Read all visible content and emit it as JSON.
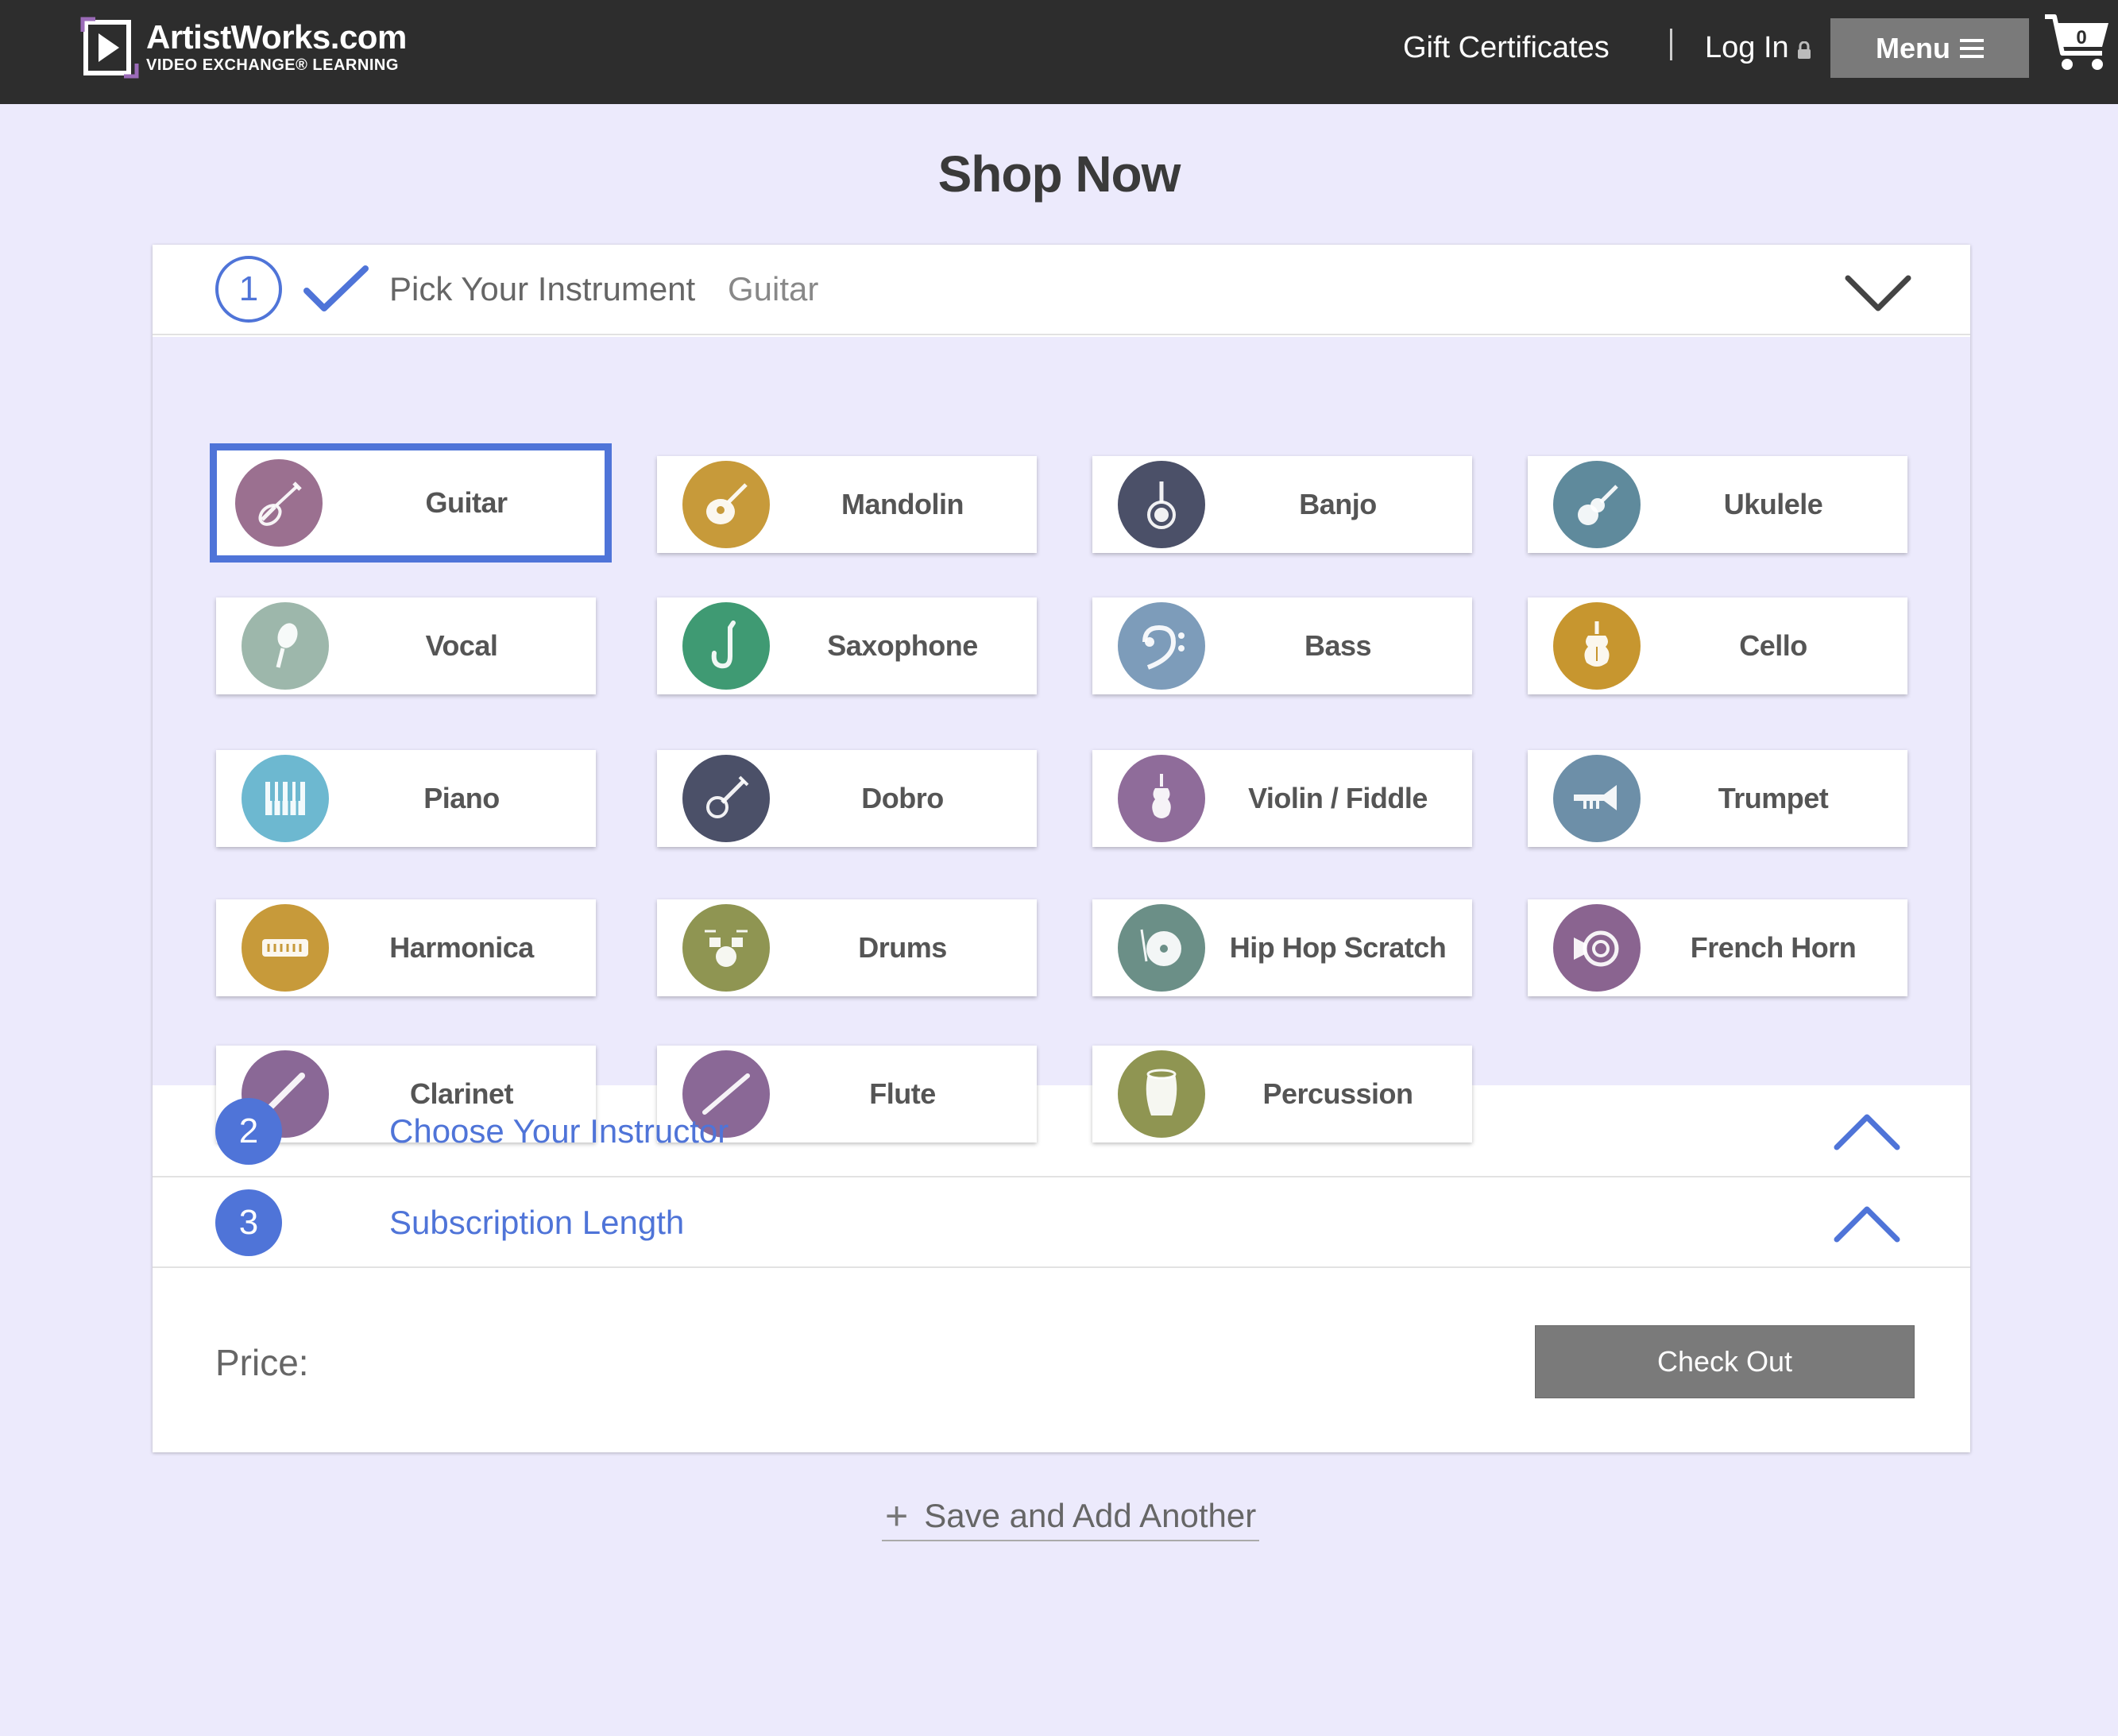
{
  "header": {
    "logo_title": "ArtistWorks.com",
    "logo_subtitle": "VIDEO EXCHANGE® LEARNING",
    "gift_certificates": "Gift Certificates",
    "login": "Log In",
    "menu": "Menu",
    "cart_count": "0"
  },
  "page_title": "Shop Now",
  "steps": [
    {
      "number": "1",
      "label": "Pick Your Instrument",
      "value": "Guitar",
      "state": "complete"
    },
    {
      "number": "2",
      "label": "Choose Your Instructor",
      "value": "",
      "state": "pending"
    },
    {
      "number": "3",
      "label": "Subscription Length",
      "value": "",
      "state": "pending"
    }
  ],
  "instruments": [
    {
      "name": "Guitar",
      "color": "#9b7090",
      "icon": "guitar-icon",
      "selected": true
    },
    {
      "name": "Mandolin",
      "color": "#c79a3a",
      "icon": "mandolin-icon",
      "selected": false
    },
    {
      "name": "Banjo",
      "color": "#4b5068",
      "icon": "banjo-icon",
      "selected": false
    },
    {
      "name": "Ukulele",
      "color": "#5f8a9c",
      "icon": "ukulele-icon",
      "selected": false
    },
    {
      "name": "Vocal",
      "color": "#9db7ab",
      "icon": "microphone-icon",
      "selected": false
    },
    {
      "name": "Saxophone",
      "color": "#3f9a73",
      "icon": "saxophone-icon",
      "selected": false
    },
    {
      "name": "Bass",
      "color": "#7d9cba",
      "icon": "bass-clef-icon",
      "selected": false
    },
    {
      "name": "Cello",
      "color": "#c7962f",
      "icon": "cello-icon",
      "selected": false
    },
    {
      "name": "Piano",
      "color": "#6db8d0",
      "icon": "piano-icon",
      "selected": false
    },
    {
      "name": "Dobro",
      "color": "#4b5068",
      "icon": "dobro-icon",
      "selected": false
    },
    {
      "name": "Violin / Fiddle",
      "color": "#8f6c9a",
      "icon": "violin-icon",
      "selected": false
    },
    {
      "name": "Trumpet",
      "color": "#6d8fa8",
      "icon": "trumpet-icon",
      "selected": false
    },
    {
      "name": "Harmonica",
      "color": "#c79a3a",
      "icon": "harmonica-icon",
      "selected": false
    },
    {
      "name": "Drums",
      "color": "#8f9552",
      "icon": "drums-icon",
      "selected": false
    },
    {
      "name": "Hip Hop Scratch",
      "color": "#6b8f87",
      "icon": "turntable-icon",
      "selected": false
    },
    {
      "name": "French Horn",
      "color": "#8a6490",
      "icon": "french-horn-icon",
      "selected": false
    },
    {
      "name": "Clarinet",
      "color": "#8a6896",
      "icon": "clarinet-icon",
      "selected": false
    },
    {
      "name": "Flute",
      "color": "#8a6896",
      "icon": "flute-icon",
      "selected": false
    },
    {
      "name": "Percussion",
      "color": "#8f9552",
      "icon": "conga-icon",
      "selected": false
    }
  ],
  "price": {
    "label": "Price:",
    "value": ""
  },
  "checkout": "Check Out",
  "save_add_another": "Save and Add Another",
  "colors": {
    "accent": "#4f74d8",
    "header": "#2d2d2d",
    "background": "#eceafc",
    "button": "#7a7a7a"
  }
}
